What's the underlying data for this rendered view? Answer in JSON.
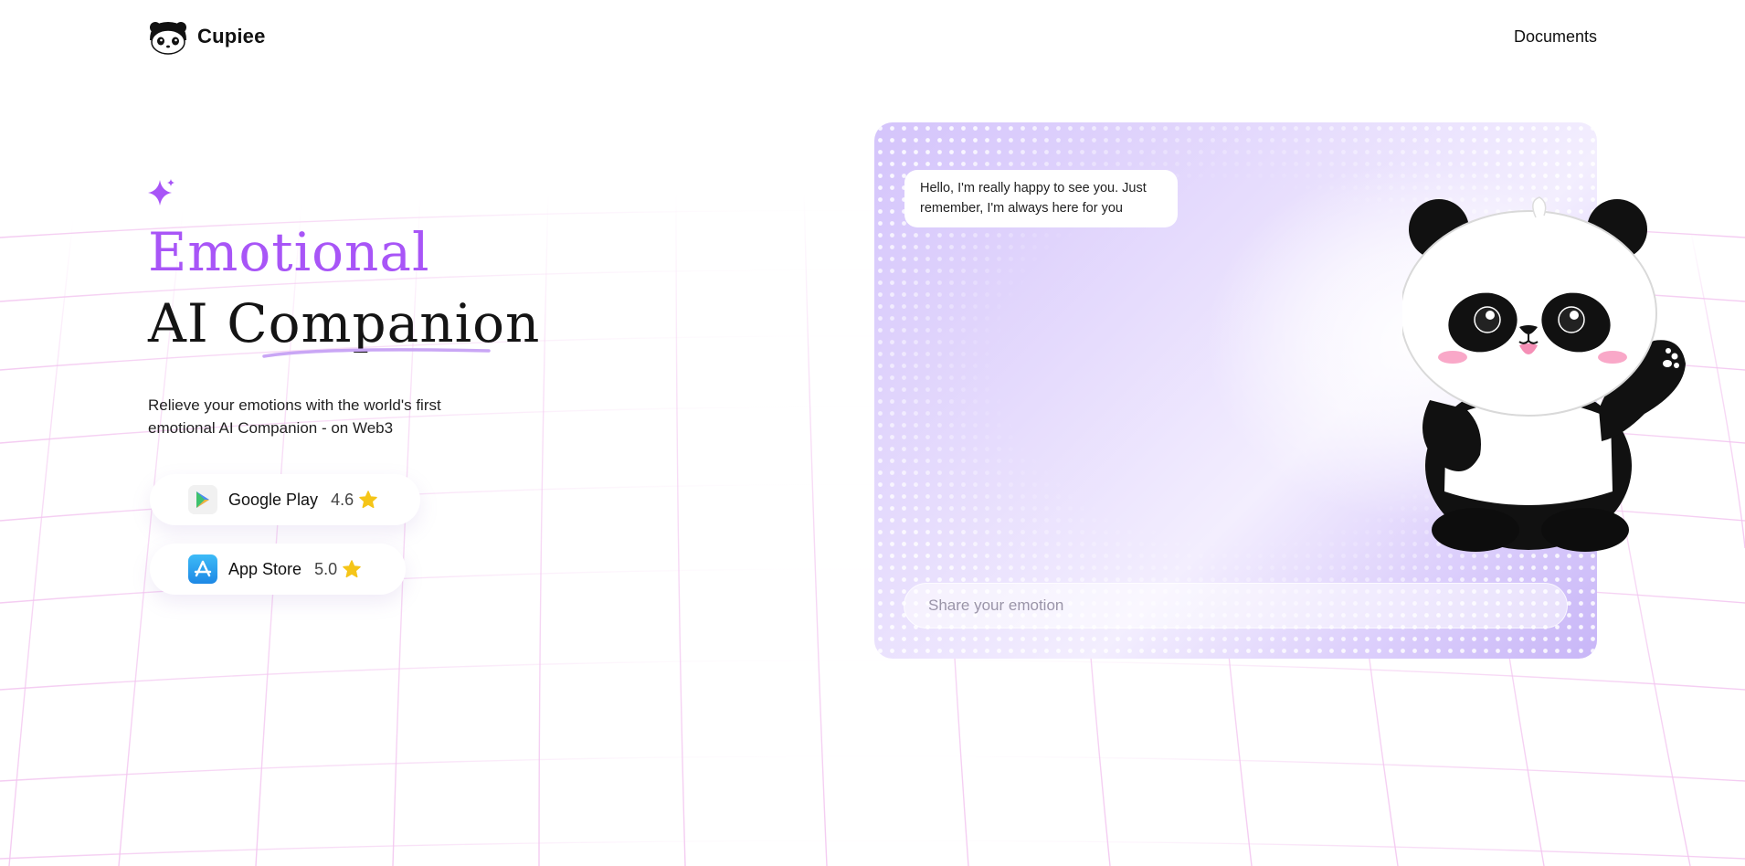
{
  "header": {
    "brand": "Cupiee",
    "nav_documents": "Documents"
  },
  "hero": {
    "title_line1": "Emotional",
    "title_line2": "AI Companion",
    "subtitle_line1": "Relieve your emotions with the world's first",
    "subtitle_line2": "emotional AI Companion - on Web3",
    "accent_color": "#a855f7"
  },
  "stores": [
    {
      "name": "Google Play",
      "rating": "4.6",
      "icon": "google-play-icon"
    },
    {
      "name": "App Store",
      "rating": "5.0",
      "icon": "app-store-icon"
    }
  ],
  "chat": {
    "greeting": "Hello, I'm really happy to see you. Just remember, I'm always here for you",
    "input_placeholder": "Share your emotion"
  },
  "colors": {
    "star": "#f5c518",
    "card_lavender": "#d4c4fb"
  }
}
